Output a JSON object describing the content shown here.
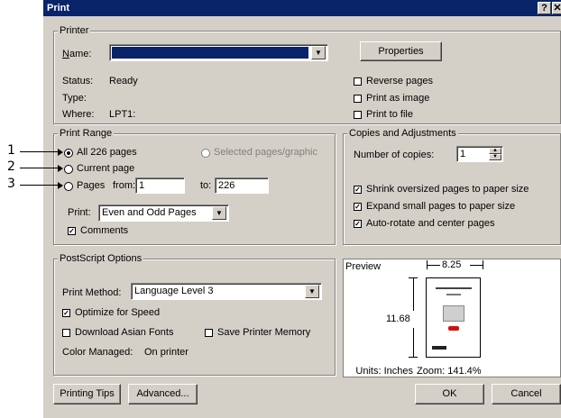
{
  "dialog": {
    "title": "Print",
    "help_btn": "?",
    "close_btn": "✕"
  },
  "printer": {
    "group_label": "Printer",
    "name_label": "Name:",
    "name_value": "",
    "properties_btn": "Properties",
    "status_label": "Status:",
    "status_value": "Ready",
    "type_label": "Type:",
    "type_value": "",
    "where_label": "Where:",
    "where_value": "LPT1:",
    "reverse_pages": "Reverse pages",
    "print_as_image": "Print as image",
    "print_to_file": "Print to file"
  },
  "print_range": {
    "group_label": "Print Range",
    "all_pages": "All 226 pages",
    "selected_pages": "Selected pages/graphic",
    "current_page": "Current page",
    "pages_label": "Pages",
    "from_label": "from:",
    "from_value": "1",
    "to_label": "to:",
    "to_value": "226",
    "print_label": "Print:",
    "print_value": "Even and Odd Pages",
    "comments": "Comments"
  },
  "copies": {
    "group_label": "Copies and Adjustments",
    "number_label": "Number of copies:",
    "number_value": "1",
    "shrink": "Shrink oversized pages to paper size",
    "expand": "Expand small pages to paper size",
    "autorotate": "Auto-rotate and center pages"
  },
  "postscript": {
    "group_label": "PostScript Options",
    "method_label": "Print Method:",
    "method_value": "Language Level 3",
    "optimize": "Optimize for Speed",
    "download_fonts": "Download Asian Fonts",
    "save_memory": "Save Printer Memory",
    "color_label": "Color Managed:",
    "color_value": "On printer"
  },
  "preview": {
    "label": "Preview",
    "width": "8.25",
    "height": "11.68",
    "units": "Units: Inches",
    "zoom": "Zoom: 141.4%"
  },
  "buttons": {
    "tips": "Printing Tips",
    "advanced": "Advanced...",
    "ok": "OK",
    "cancel": "Cancel"
  },
  "callouts": [
    "1",
    "2",
    "3"
  ]
}
